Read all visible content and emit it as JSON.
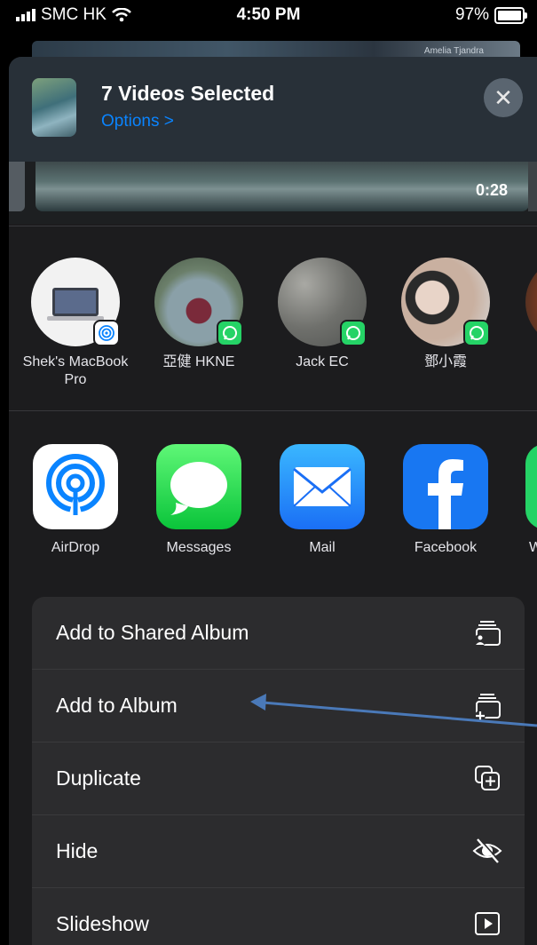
{
  "status": {
    "carrier": "SMC HK",
    "time": "4:50 PM",
    "battery": "97%"
  },
  "background": {
    "name": "Amelia Tjandra"
  },
  "header": {
    "title": "7 Videos Selected",
    "options": "Options >",
    "close": "✕"
  },
  "preview": {
    "duration": "0:28"
  },
  "people": [
    {
      "name": "Shek's MacBook Pro"
    },
    {
      "name": "亞健 HKNE"
    },
    {
      "name": "Jack EC"
    },
    {
      "name": "鄧小霞"
    }
  ],
  "apps": [
    {
      "name": "AirDrop"
    },
    {
      "name": "Messages"
    },
    {
      "name": "Mail"
    },
    {
      "name": "Facebook"
    },
    {
      "name": "W"
    }
  ],
  "actions": [
    {
      "label": "Add to Shared Album",
      "icon": "shared-album-icon"
    },
    {
      "label": "Add to Album",
      "icon": "add-album-icon"
    },
    {
      "label": "Duplicate",
      "icon": "duplicate-icon"
    },
    {
      "label": "Hide",
      "icon": "hide-icon"
    },
    {
      "label": "Slideshow",
      "icon": "slideshow-icon"
    }
  ],
  "colors": {
    "accent": "#0a84ff",
    "whatsapp": "#25d366",
    "annotation_arrow": "#4a79b8"
  }
}
